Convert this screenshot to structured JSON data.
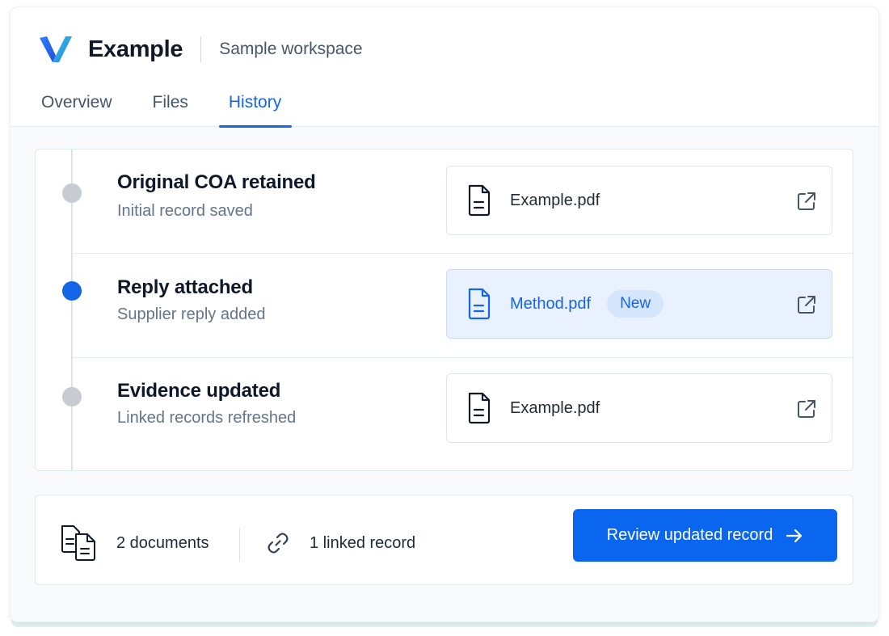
{
  "header": {
    "brand": "Example",
    "workspace": "Sample workspace",
    "tabs": [
      {
        "label": "Overview",
        "active": false
      },
      {
        "label": "Files",
        "active": false
      },
      {
        "label": "History",
        "active": true
      }
    ]
  },
  "events": [
    {
      "title": "Original COA retained",
      "subtitle": "Initial record saved",
      "state": "past",
      "file": {
        "name": "Example.pdf",
        "icon": "document-icon",
        "highlight": false,
        "badge": null
      }
    },
    {
      "title": "Reply attached",
      "subtitle": "Supplier reply added",
      "state": "current",
      "file": {
        "name": "Method.pdf",
        "icon": "document-icon",
        "highlight": true,
        "badge": "New"
      }
    },
    {
      "title": "Evidence updated",
      "subtitle": "Linked records refreshed",
      "state": "past",
      "file": {
        "name": "Example.pdf",
        "icon": "document-icon",
        "highlight": false,
        "badge": null
      }
    }
  ],
  "footer": {
    "documents": "2 documents",
    "linked": "1 linked record",
    "cta_label": "Review updated record"
  },
  "colors": {
    "accent": "#1565e8",
    "cta": "#0a66ee",
    "badge_bg": "#d5e5fb",
    "highlight_bg": "#e8f1fd",
    "inactive_dot": "#c7ccd3"
  }
}
